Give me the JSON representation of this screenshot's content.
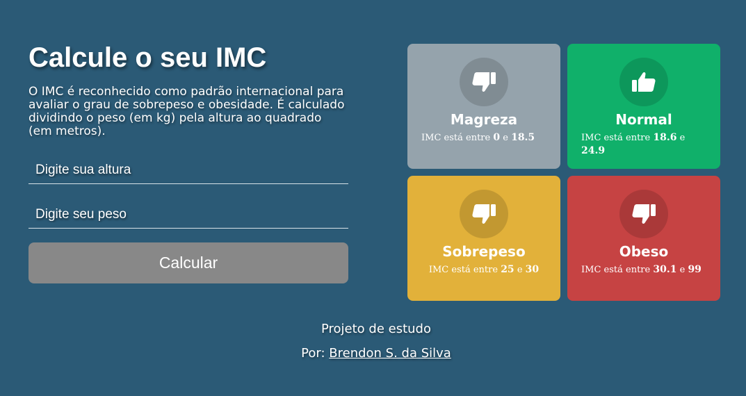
{
  "heading": "Calcule o seu IMC",
  "description": "O IMC é reconhecido como padrão internacional para avaliar o grau de sobrepeso e obesidade. É calculado dividindo o peso (em kg) pela altura ao quadrado (em metros).",
  "form": {
    "height_placeholder": "Digite sua altura",
    "height_value": "",
    "weight_placeholder": "Digite seu peso",
    "weight_value": "",
    "calculate_label": "Calcular"
  },
  "cards": [
    {
      "title": "Magreza",
      "prefix": "IMC está entre",
      "min": "0",
      "joiner": "e",
      "max": "18.5",
      "icon": "thumbs-down-icon",
      "color": "#95a3ac"
    },
    {
      "title": "Normal",
      "prefix": "IMC está entre",
      "min": "18.6",
      "joiner": "e",
      "max": "24.9",
      "icon": "thumbs-up-icon",
      "color": "#10b06a"
    },
    {
      "title": "Sobrepeso",
      "prefix": "IMC está entre",
      "min": "25",
      "joiner": "e",
      "max": "30",
      "icon": "thumbs-down-icon",
      "color": "#e2b13a"
    },
    {
      "title": "Obeso",
      "prefix": "IMC está entre",
      "min": "30.1",
      "joiner": "e",
      "max": "99",
      "icon": "thumbs-down-icon",
      "color": "#c64343"
    }
  ],
  "footer": {
    "project_label": "Projeto de estudo",
    "by_label": "Por:",
    "author": "Brendon S. da Silva"
  }
}
